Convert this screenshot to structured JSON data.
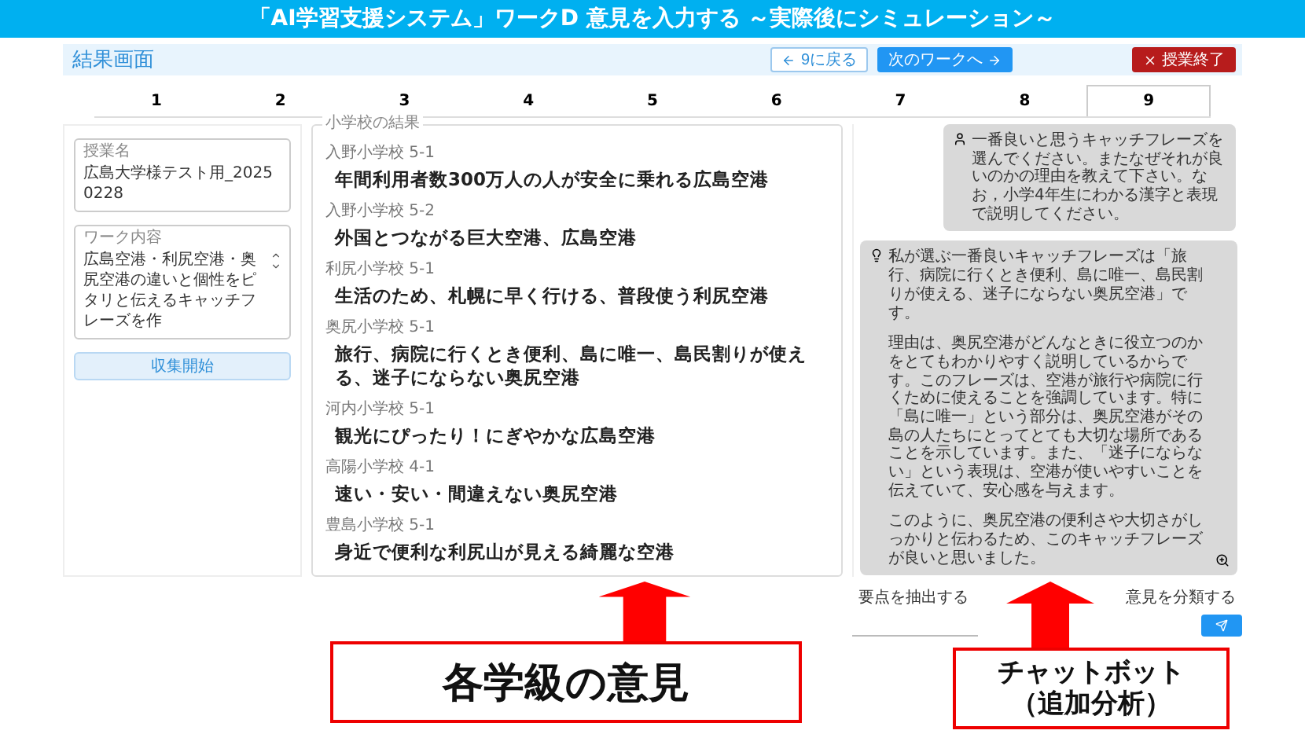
{
  "slide_title": "「AI学習支援システム」ワークD  意見を入力する  ～実際後にシミュレーション～",
  "header": {
    "title": "結果画面",
    "buttons": [
      {
        "label": "9に戻る",
        "kind": "back"
      },
      {
        "label": "次のワークへ",
        "kind": "next"
      },
      {
        "label": "授業終了",
        "kind": "end"
      }
    ]
  },
  "tabs": [
    {
      "label": "1",
      "selected": false
    },
    {
      "label": "2",
      "selected": false
    },
    {
      "label": "3",
      "selected": false
    },
    {
      "label": "4",
      "selected": false
    },
    {
      "label": "5",
      "selected": false
    },
    {
      "label": "6",
      "selected": false
    },
    {
      "label": "7",
      "selected": false
    },
    {
      "label": "8",
      "selected": false
    },
    {
      "label": "9",
      "selected": true
    }
  ],
  "left_panel": {
    "fields": [
      {
        "label": "授業名",
        "value": "広島大学様テスト用_20250228"
      },
      {
        "label": "ワーク内容",
        "value": "広島空港・利尻空港・奥尻空港の違いと個性をピタリと伝えるキャッチフレーズを作"
      }
    ],
    "button": "収集開始"
  },
  "results": {
    "label": "小学校の結果",
    "items": [
      {
        "class": "入野小学校 5-1",
        "text": "年間利用者数300万人の人が安全に乗れる広島空港"
      },
      {
        "class": "入野小学校 5-2",
        "text": "外国とつながる巨大空港、広島空港"
      },
      {
        "class": "利尻小学校 5-1",
        "text": "生活のため、札幌に早く行ける、普段使う利尻空港"
      },
      {
        "class": "奥尻小学校 5-1",
        "text": "旅行、病院に行くとき便利、島に唯一、島民割りが使える、迷子にならない奥尻空港"
      },
      {
        "class": "河内小学校 5-1",
        "text": "観光にぴったり！にぎやかな広島空港"
      },
      {
        "class": "高陽小学校 4-1",
        "text": "速い・安い・間違えない奥尻空港"
      },
      {
        "class": "豊島小学校 5-1",
        "text": "身近で便利な利尻山が見える綺麗な空港"
      }
    ]
  },
  "chat": {
    "messages": [
      {
        "kind": "user",
        "paragraphs": [
          "一番良いと思うキャッチフレーズを選んでください。またなぜそれが良いのかの理由を教えて下さい。なお，小学4年生にわかる漢字と表現で説明してください。"
        ]
      },
      {
        "kind": "bot",
        "paragraphs": [
          "私が選ぶ一番良いキャッチフレーズは「旅行、病院に行くとき便利、島に唯一、島民割りが使える、迷子にならない奥尻空港」です。",
          "理由は、奥尻空港がどんなときに役立つのかをとてもわかりやすく説明しているからです。このフレーズは、空港が旅行や病院に行くために使えることを強調しています。特に「島に唯一」という部分は、奥尻空港がその島の人たちにとってとても大切な場所であることを示しています。また、「迷子にならない」という表現は、空港が使いやすいことを伝えていて、安心感を与えます。",
          "このように、奥尻空港の便利さや大切さがしっかりと伝わるため、このキャッチフレーズが良いと思いました。"
        ]
      }
    ],
    "actions": [
      "要点を抽出する",
      "意見を分類する"
    ]
  },
  "callouts": [
    {
      "lines": [
        "各学級の意見"
      ]
    },
    {
      "lines": [
        "チャットボット",
        "（追加分析）"
      ]
    }
  ]
}
